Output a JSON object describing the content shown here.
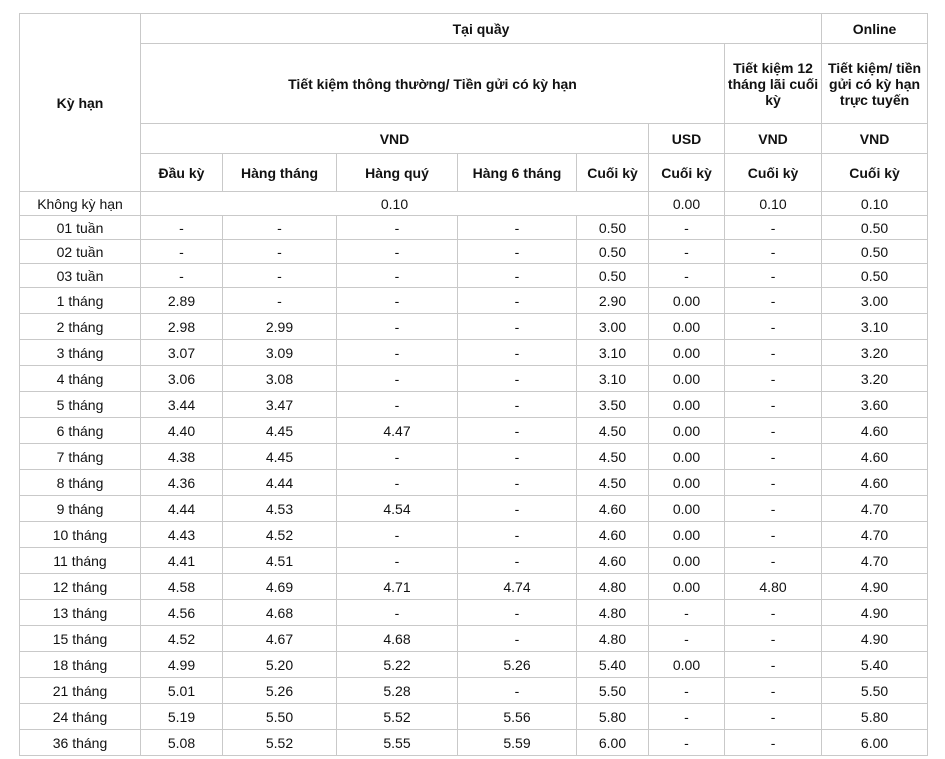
{
  "header": {
    "term": "Kỳ hạn",
    "counter": "Tại quầy",
    "online": "Online",
    "regular_savings": "Tiết kiệm thông thường/ Tiền gửi có kỳ hạn",
    "savings_12m": "Tiết kiệm 12 tháng lãi cuối kỳ",
    "online_savings": "Tiết kiệm/ tiền gửi có kỳ hạn trực tuyến",
    "currency_vnd": "VND",
    "currency_usd": "USD",
    "col_dau_ky": "Đầu kỳ",
    "col_hang_thang": "Hàng tháng",
    "col_hang_quy": "Hàng quý",
    "col_hang_6_thang": "Hàng 6 tháng",
    "col_cuoi_ky": "Cuối kỳ",
    "col_cuoi_ky_online": "Cuối  kỳ"
  },
  "no_term_row": {
    "term": "Không kỳ hạn",
    "vnd_merged": "0.10",
    "usd": "0.00",
    "savings_12m": "0.10",
    "online": "0.10"
  },
  "rows": [
    {
      "term": "01 tuần",
      "dau_ky": "-",
      "hang_thang": "-",
      "hang_quy": "-",
      "hang_6_thang": "-",
      "cuoi_ky": "0.50",
      "usd": "-",
      "savings_12m": "-",
      "online": "0.50"
    },
    {
      "term": "02 tuần",
      "dau_ky": "-",
      "hang_thang": "-",
      "hang_quy": "-",
      "hang_6_thang": "-",
      "cuoi_ky": "0.50",
      "usd": "-",
      "savings_12m": "-",
      "online": "0.50"
    },
    {
      "term": "03 tuần",
      "dau_ky": "-",
      "hang_thang": "-",
      "hang_quy": "-",
      "hang_6_thang": "-",
      "cuoi_ky": "0.50",
      "usd": "-",
      "savings_12m": "-",
      "online": "0.50"
    },
    {
      "term": "1 tháng",
      "dau_ky": "2.89",
      "hang_thang": "-",
      "hang_quy": "-",
      "hang_6_thang": "-",
      "cuoi_ky": "2.90",
      "usd": "0.00",
      "savings_12m": "-",
      "online": "3.00"
    },
    {
      "term": "2 tháng",
      "dau_ky": "2.98",
      "hang_thang": "2.99",
      "hang_quy": "-",
      "hang_6_thang": "-",
      "cuoi_ky": "3.00",
      "usd": "0.00",
      "savings_12m": "-",
      "online": "3.10"
    },
    {
      "term": "3 tháng",
      "dau_ky": "3.07",
      "hang_thang": "3.09",
      "hang_quy": "-",
      "hang_6_thang": "-",
      "cuoi_ky": "3.10",
      "usd": "0.00",
      "savings_12m": "-",
      "online": "3.20"
    },
    {
      "term": "4 tháng",
      "dau_ky": "3.06",
      "hang_thang": "3.08",
      "hang_quy": "-",
      "hang_6_thang": "-",
      "cuoi_ky": "3.10",
      "usd": "0.00",
      "savings_12m": "-",
      "online": "3.20"
    },
    {
      "term": "5 tháng",
      "dau_ky": "3.44",
      "hang_thang": "3.47",
      "hang_quy": "-",
      "hang_6_thang": "-",
      "cuoi_ky": "3.50",
      "usd": "0.00",
      "savings_12m": "-",
      "online": "3.60"
    },
    {
      "term": "6 tháng",
      "dau_ky": "4.40",
      "hang_thang": "4.45",
      "hang_quy": "4.47",
      "hang_6_thang": "-",
      "cuoi_ky": "4.50",
      "usd": "0.00",
      "savings_12m": "-",
      "online": "4.60"
    },
    {
      "term": "7  tháng",
      "dau_ky": "4.38",
      "hang_thang": "4.45",
      "hang_quy": "-",
      "hang_6_thang": "-",
      "cuoi_ky": "4.50",
      "usd": "0.00",
      "savings_12m": "-",
      "online": "4.60"
    },
    {
      "term": "8 tháng",
      "dau_ky": "4.36",
      "hang_thang": "4.44",
      "hang_quy": "-",
      "hang_6_thang": "-",
      "cuoi_ky": "4.50",
      "usd": "0.00",
      "savings_12m": "-",
      "online": "4.60"
    },
    {
      "term": "9 tháng",
      "dau_ky": "4.44",
      "hang_thang": "4.53",
      "hang_quy": "4.54",
      "hang_6_thang": "-",
      "cuoi_ky": "4.60",
      "usd": "0.00",
      "savings_12m": "-",
      "online": "4.70"
    },
    {
      "term": "10 tháng",
      "dau_ky": "4.43",
      "hang_thang": "4.52",
      "hang_quy": "-",
      "hang_6_thang": "-",
      "cuoi_ky": "4.60",
      "usd": "0.00",
      "savings_12m": "-",
      "online": "4.70"
    },
    {
      "term": "11 tháng",
      "dau_ky": "4.41",
      "hang_thang": "4.51",
      "hang_quy": "-",
      "hang_6_thang": "-",
      "cuoi_ky": "4.60",
      "usd": "0.00",
      "savings_12m": "-",
      "online": "4.70"
    },
    {
      "term": "12 tháng",
      "dau_ky": "4.58",
      "hang_thang": "4.69",
      "hang_quy": "4.71",
      "hang_6_thang": "4.74",
      "cuoi_ky": "4.80",
      "usd": "0.00",
      "savings_12m": "4.80",
      "online": "4.90"
    },
    {
      "term": "13 tháng",
      "dau_ky": "4.56",
      "hang_thang": "4.68",
      "hang_quy": "-",
      "hang_6_thang": "-",
      "cuoi_ky": "4.80",
      "usd": "-",
      "savings_12m": "-",
      "online": "4.90"
    },
    {
      "term": "15 tháng",
      "dau_ky": "4.52",
      "hang_thang": "4.67",
      "hang_quy": "4.68",
      "hang_6_thang": "-",
      "cuoi_ky": "4.80",
      "usd": "-",
      "savings_12m": "-",
      "online": "4.90"
    },
    {
      "term": "18 tháng",
      "dau_ky": "4.99",
      "hang_thang": "5.20",
      "hang_quy": "5.22",
      "hang_6_thang": "5.26",
      "cuoi_ky": "5.40",
      "usd": "0.00",
      "savings_12m": "-",
      "online": "5.40"
    },
    {
      "term": "21 tháng",
      "dau_ky": "5.01",
      "hang_thang": "5.26",
      "hang_quy": "5.28",
      "hang_6_thang": "-",
      "cuoi_ky": "5.50",
      "usd": "-",
      "savings_12m": "-",
      "online": "5.50"
    },
    {
      "term": "24 tháng",
      "dau_ky": "5.19",
      "hang_thang": "5.50",
      "hang_quy": "5.52",
      "hang_6_thang": "5.56",
      "cuoi_ky": "5.80",
      "usd": "-",
      "savings_12m": "-",
      "online": "5.80"
    },
    {
      "term": "36 tháng",
      "dau_ky": "5.08",
      "hang_thang": "5.52",
      "hang_quy": "5.55",
      "hang_6_thang": "5.59",
      "cuoi_ky": "6.00",
      "usd": "-",
      "savings_12m": "-",
      "online": "6.00"
    }
  ]
}
